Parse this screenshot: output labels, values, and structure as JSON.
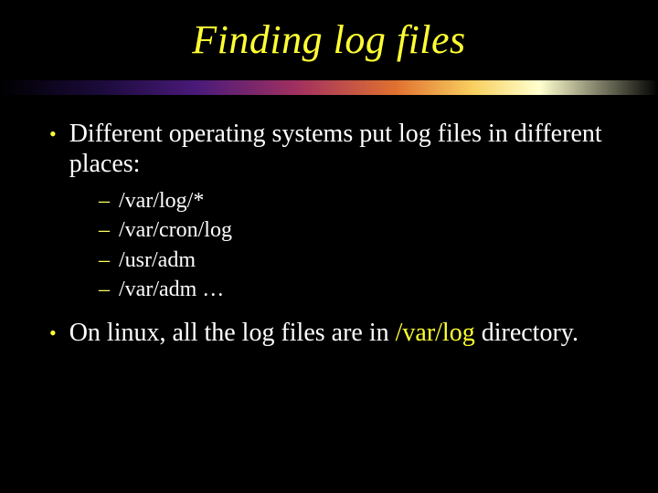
{
  "title": "Finding log files",
  "bullets": [
    {
      "text": "Different operating systems put log files in different places:",
      "sub": [
        "/var/log/*",
        "/var/cron/log",
        "/usr/adm",
        "/var/adm …"
      ]
    },
    {
      "pre": "On linux, all the log files are in ",
      "hl": "/var/log",
      "post": " directory."
    }
  ]
}
